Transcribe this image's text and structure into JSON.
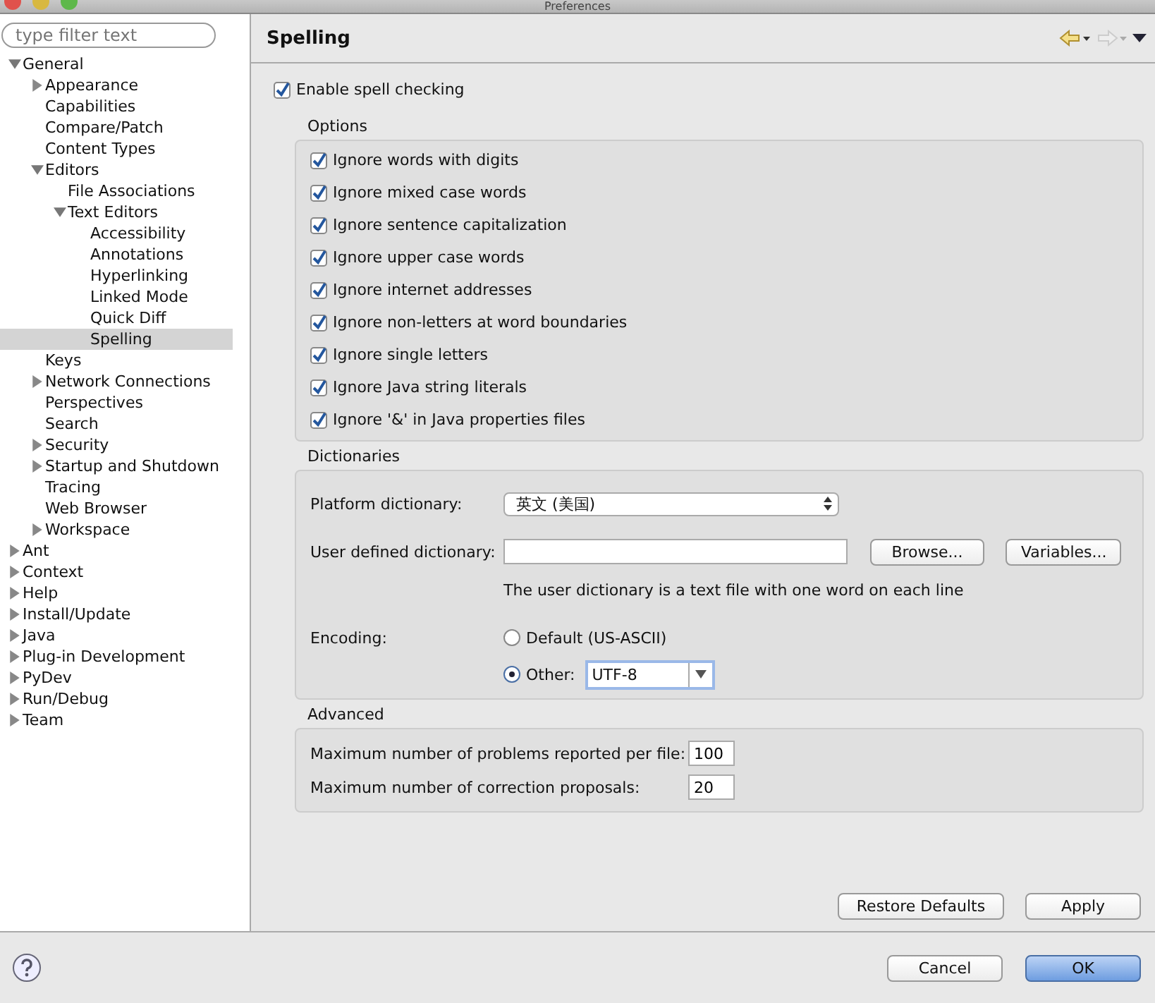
{
  "window": {
    "title": "Preferences"
  },
  "filter": {
    "placeholder": "type filter text"
  },
  "tree": [
    {
      "label": "General",
      "expanded": true,
      "selected": false,
      "children": [
        {
          "label": "Appearance",
          "expanded": false,
          "selected": false
        },
        {
          "label": "Capabilities",
          "selected": false
        },
        {
          "label": "Compare/Patch",
          "selected": false
        },
        {
          "label": "Content Types",
          "selected": false
        },
        {
          "label": "Editors",
          "expanded": true,
          "selected": false,
          "children": [
            {
              "label": "File Associations",
              "selected": false
            },
            {
              "label": "Text Editors",
              "expanded": true,
              "selected": false,
              "children": [
                {
                  "label": "Accessibility",
                  "selected": false
                },
                {
                  "label": "Annotations",
                  "selected": false
                },
                {
                  "label": "Hyperlinking",
                  "selected": false
                },
                {
                  "label": "Linked Mode",
                  "selected": false
                },
                {
                  "label": "Quick Diff",
                  "selected": false
                },
                {
                  "label": "Spelling",
                  "selected": true
                }
              ]
            }
          ]
        },
        {
          "label": "Keys",
          "selected": false
        },
        {
          "label": "Network Connections",
          "expanded": false,
          "selected": false
        },
        {
          "label": "Perspectives",
          "selected": false
        },
        {
          "label": "Search",
          "selected": false
        },
        {
          "label": "Security",
          "expanded": false,
          "selected": false
        },
        {
          "label": "Startup and Shutdown",
          "expanded": false,
          "selected": false
        },
        {
          "label": "Tracing",
          "selected": false
        },
        {
          "label": "Web Browser",
          "selected": false
        },
        {
          "label": "Workspace",
          "expanded": false,
          "selected": false
        }
      ]
    },
    {
      "label": "Ant",
      "expanded": false,
      "selected": false
    },
    {
      "label": "Context",
      "expanded": false,
      "selected": false
    },
    {
      "label": "Help",
      "expanded": false,
      "selected": false
    },
    {
      "label": "Install/Update",
      "expanded": false,
      "selected": false
    },
    {
      "label": "Java",
      "expanded": false,
      "selected": false
    },
    {
      "label": "Plug-in Development",
      "expanded": false,
      "selected": false
    },
    {
      "label": "PyDev",
      "expanded": false,
      "selected": false
    },
    {
      "label": "Run/Debug",
      "expanded": false,
      "selected": false
    },
    {
      "label": "Team",
      "expanded": false,
      "selected": false
    }
  ],
  "page": {
    "title": "Spelling",
    "enable": {
      "label": "Enable spell checking",
      "checked": true
    }
  },
  "options": {
    "title": "Options",
    "items": [
      {
        "label": "Ignore words with digits",
        "checked": true
      },
      {
        "label": "Ignore mixed case words",
        "checked": true
      },
      {
        "label": "Ignore sentence capitalization",
        "checked": true
      },
      {
        "label": "Ignore upper case words",
        "checked": true
      },
      {
        "label": "Ignore internet addresses",
        "checked": true
      },
      {
        "label": "Ignore non-letters at word boundaries",
        "checked": true
      },
      {
        "label": "Ignore single letters",
        "checked": true
      },
      {
        "label": "Ignore Java string literals",
        "checked": true
      },
      {
        "label": "Ignore '&' in Java properties files",
        "checked": true
      }
    ]
  },
  "dictionaries": {
    "title": "Dictionaries",
    "platform_label": "Platform dictionary:",
    "platform_value": "英文 (美国)",
    "user_label": "User defined dictionary:",
    "browse": "Browse...",
    "variables": "Variables...",
    "hint": "The user dictionary is a text file with one word on each line",
    "encoding_label": "Encoding:",
    "encodings": [
      {
        "label": "Default (US-ASCII)",
        "selected": false
      },
      {
        "label": "Other:",
        "selected": true,
        "value": "UTF-8"
      }
    ]
  },
  "advanced": {
    "title": "Advanced",
    "rows": [
      {
        "label": "Maximum number of problems reported per file:",
        "value": "100"
      },
      {
        "label": "Maximum number of correction proposals:",
        "value": "20"
      }
    ]
  },
  "buttons": {
    "restore": "Restore Defaults",
    "apply": "Apply",
    "cancel": "Cancel",
    "ok": "OK"
  }
}
